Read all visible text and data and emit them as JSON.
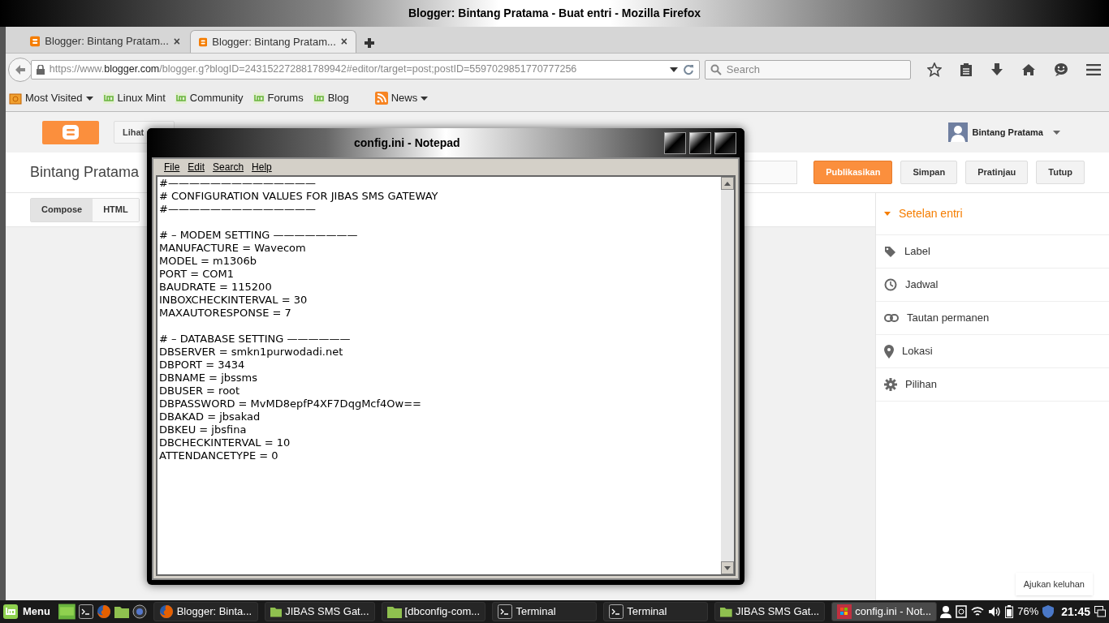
{
  "window": {
    "title": "Blogger: Bintang Pratama - Buat entri - Mozilla Firefox"
  },
  "tabs": [
    {
      "label": "Blogger: Bintang Pratam...",
      "close": "×",
      "selected": false
    },
    {
      "label": "Blogger: Bintang Pratam...",
      "close": "×",
      "selected": true
    }
  ],
  "address_bar": {
    "scheme": "https://www.",
    "domain": "blogger.com",
    "path": "/blogger.g?blogID=243152272881789942#editor/target=post;postID=5597029851770777256"
  },
  "search": {
    "placeholder": "Search"
  },
  "bookmarks": [
    {
      "label": "Most Visited",
      "kind": "folder"
    },
    {
      "label": "Linux Mint",
      "kind": "mint"
    },
    {
      "label": "Community",
      "kind": "mint"
    },
    {
      "label": "Forums",
      "kind": "mint"
    },
    {
      "label": "Blog",
      "kind": "mint"
    },
    {
      "label": "News",
      "kind": "feed"
    }
  ],
  "blogger": {
    "view_button": "Lihat",
    "user": "Bintang Pratama",
    "blog_title": "Bintang Pratama",
    "actions": [
      {
        "label": "Publikasikan",
        "primary": true
      },
      {
        "label": "Simpan",
        "primary": false
      },
      {
        "label": "Pratinjau",
        "primary": false
      },
      {
        "label": "Tutup",
        "primary": false
      }
    ],
    "mode_tabs": [
      {
        "label": "Compose",
        "selected": true
      },
      {
        "label": "HTML",
        "selected": false
      }
    ],
    "settings_title": "Setelan entri",
    "settings": [
      {
        "label": "Label",
        "kind": "tag"
      },
      {
        "label": "Jadwal",
        "kind": "clock"
      },
      {
        "label": "Tautan permanen",
        "kind": "link"
      },
      {
        "label": "Lokasi",
        "kind": "pin"
      },
      {
        "label": "Pilihan",
        "kind": "gear"
      }
    ],
    "feedback_button": "Ajukan keluhan"
  },
  "notepad": {
    "title": "config.ini - Notepad",
    "menu": [
      "File",
      "Edit",
      "Search",
      "Help"
    ],
    "sections": [
      [
        "#——————————————",
        "# CONFIGURATION VALUES FOR JIBAS SMS GATEWAY",
        "#——————————————"
      ],
      [
        "# – MODEM SETTING ————————",
        "MANUFACTURE = Wavecom",
        "MODEL = m1306b",
        "PORT = COM1",
        "BAUDRATE = 115200",
        "INBOXCHECKINTERVAL = 30",
        "MAXAUTORESPONSE = 7"
      ],
      [
        "# – DATABASE SETTING ——————",
        "DBSERVER = smkn1purwodadi.net",
        "DBPORT = 3434",
        "DBNAME = jbssms",
        "DBUSER = root",
        "DBPASSWORD = MvMD8epfP4XF7DqgMcf4Ow==",
        "DBAKAD = jbsakad",
        "DBKEU = jbsfina",
        "DBCHECKINTERVAL = 10",
        "ATTENDANCETYPE = 0"
      ]
    ]
  },
  "taskbar": {
    "menu": "Menu",
    "windows": [
      {
        "label": "Blogger: Binta...",
        "kind": "firefox",
        "selected": false
      },
      {
        "label": "JIBAS SMS Gat...",
        "kind": "folder",
        "selected": false
      },
      {
        "label": "[dbconfig-com...",
        "kind": "folder",
        "selected": false
      },
      {
        "label": "Terminal",
        "kind": "terminal",
        "selected": false
      },
      {
        "label": "Terminal",
        "kind": "terminal",
        "selected": false
      },
      {
        "label": "JIBAS SMS Gat...",
        "kind": "folder",
        "selected": false
      },
      {
        "label": "config.ini - Not...",
        "kind": "notepad",
        "selected": true
      }
    ],
    "battery": "76%",
    "clock": "21:45"
  }
}
